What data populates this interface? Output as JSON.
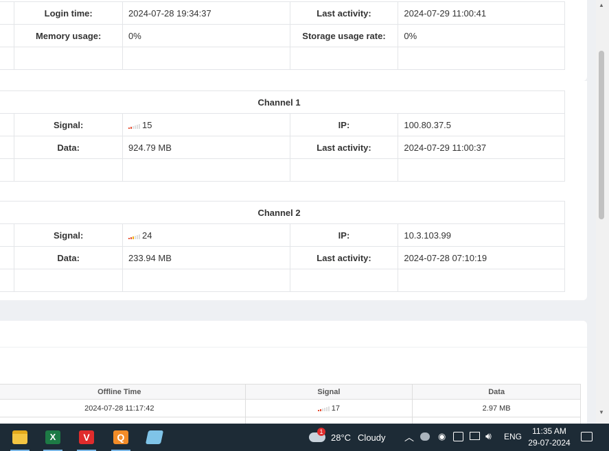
{
  "device_card": {
    "rows": [
      {
        "l1": "Login time:",
        "v1": "2024-07-28 19:34:37",
        "l2": "Last activity:",
        "v2": "2024-07-29 11:00:41"
      },
      {
        "l1": "Memory usage:",
        "v1": "0%",
        "l2": "Storage usage rate:",
        "v2": "0%"
      }
    ]
  },
  "channel1": {
    "title": "Channel 1",
    "signal_label": "Signal:",
    "signal_value": "15",
    "signal_level": 2,
    "ip_label": "IP:",
    "ip_value": "100.80.37.5",
    "data_label": "Data:",
    "data_value": "924.79 MB",
    "activity_label": "Last activity:",
    "activity_value": "2024-07-29 11:00:37"
  },
  "channel2": {
    "title": "Channel 2",
    "signal_label": "Signal:",
    "signal_value": "24",
    "signal_level": 3,
    "ip_label": "IP:",
    "ip_value": "10.3.103.99",
    "data_label": "Data:",
    "data_value": "233.94 MB",
    "activity_label": "Last activity:",
    "activity_value": "2024-07-28 07:10:19"
  },
  "history_table": {
    "columns": [
      "Offline Time",
      "Signal",
      "Data"
    ],
    "rows": [
      {
        "offline_time": "2024-07-28 11:17:42",
        "signal": "17",
        "signal_level": 2,
        "data": "2.97 MB"
      }
    ]
  },
  "taskbar": {
    "apps": [
      "file-explorer",
      "excel",
      "vpn-app",
      "q-app",
      "notepad-app"
    ],
    "weather_temp": "28°C",
    "weather_text": "Cloudy",
    "weather_badge": "1",
    "language": "ENG",
    "time": "11:35 AM",
    "date": "29-07-2024"
  },
  "colors": {
    "accent": "#1fa7d9",
    "taskbar": "#1d2b36",
    "signal_low": "#e54b2f",
    "signal_mid": "#f2a900"
  }
}
